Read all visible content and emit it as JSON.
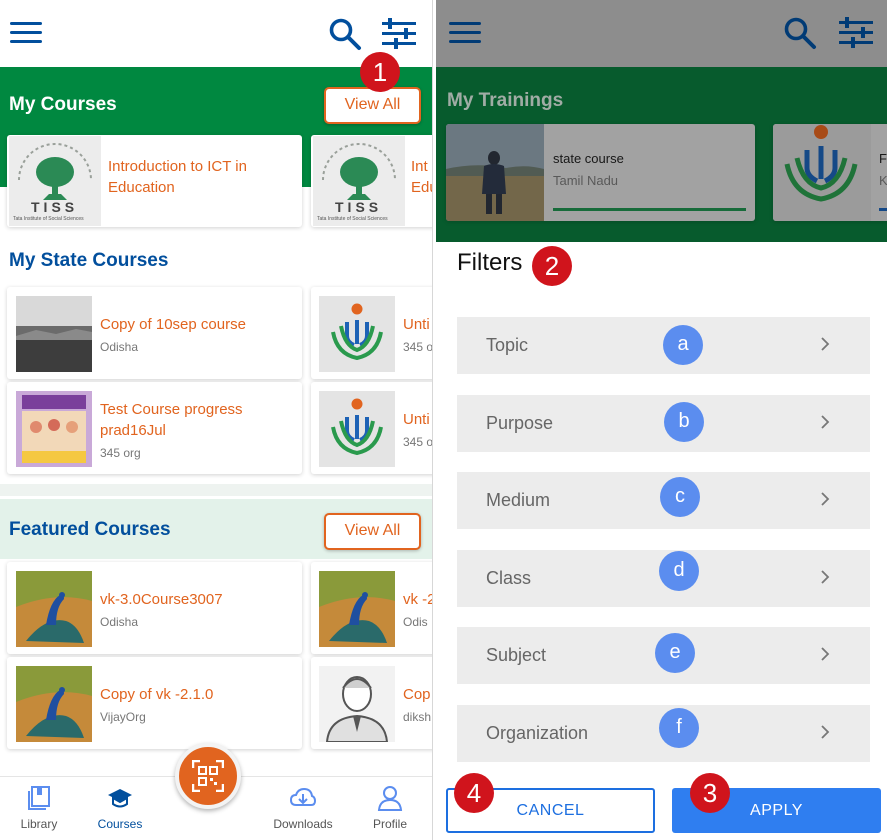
{
  "left": {
    "my_courses": {
      "title": "My Courses",
      "view_all": "View All",
      "cards": [
        {
          "title": "Introduction to ICT in Education",
          "logo_text": "TISS",
          "logo_caption": "Tata Institute of Social Sciences"
        },
        {
          "title": "Int Edu",
          "logo_text": "TISS",
          "logo_caption": "Tata Institute of Social Sciences"
        }
      ]
    },
    "my_state_courses": {
      "title": "My State Courses",
      "cards": [
        {
          "title": "Copy of 10sep course",
          "subtitle": "Odisha"
        },
        {
          "title": "Unti",
          "subtitle": "345 o"
        },
        {
          "title": "Test Course progress prad16Jul",
          "subtitle": "345 org"
        },
        {
          "title": "Unti",
          "subtitle": "345 o"
        }
      ]
    },
    "featured_courses": {
      "title": "Featured Courses",
      "view_all": "View All",
      "cards": [
        {
          "title": "vk-3.0Course3007",
          "subtitle": "Odisha"
        },
        {
          "title": "vk -2",
          "subtitle": "Odis"
        },
        {
          "title": "Copy of vk -2.1.0",
          "subtitle": "VijayOrg"
        },
        {
          "title": "Cop",
          "subtitle": "diksh"
        }
      ]
    },
    "bottom_nav": [
      {
        "label": "Library",
        "icon": "library-icon",
        "active": false
      },
      {
        "label": "Courses",
        "icon": "courses-icon",
        "active": true
      },
      {
        "label": "Downloads",
        "icon": "downloads-icon",
        "active": false
      },
      {
        "label": "Profile",
        "icon": "profile-icon",
        "active": false
      }
    ]
  },
  "right": {
    "my_trainings": {
      "title": "My Trainings",
      "cards": [
        {
          "title": "state course",
          "subtitle": "Tamil Nadu"
        },
        {
          "title": "Fo",
          "subtitle": "K"
        }
      ]
    },
    "filters": {
      "title": "Filters",
      "rows": [
        {
          "label": "Topic",
          "badge": "a"
        },
        {
          "label": "Purpose",
          "badge": "b"
        },
        {
          "label": "Medium",
          "badge": "c"
        },
        {
          "label": "Class",
          "badge": "d"
        },
        {
          "label": "Subject",
          "badge": "e"
        },
        {
          "label": "Organization",
          "badge": "f"
        }
      ],
      "cancel": "CANCEL",
      "apply": "APPLY"
    }
  },
  "annotations": {
    "one": "1",
    "two": "2",
    "three": "3",
    "four": "4"
  },
  "colors": {
    "brand_blue": "#024f9d",
    "green": "#008840",
    "orange": "#e1641f",
    "badge_blue": "#5b8def",
    "badge_red": "#d0141c",
    "apply_blue": "#2f7ef0"
  }
}
